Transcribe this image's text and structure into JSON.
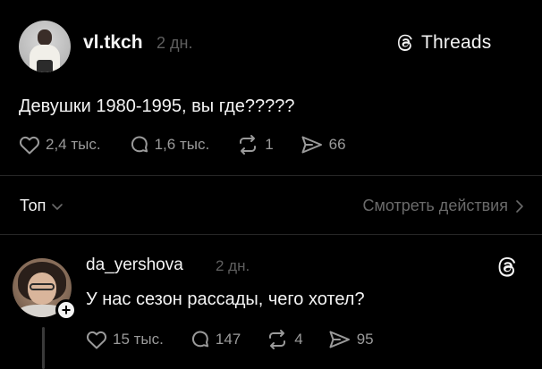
{
  "post": {
    "author": "vl.tkch",
    "time": "2 дн.",
    "brand": "Threads",
    "text": "Девушки 1980-1995, вы где?????",
    "stats": {
      "likes": "2,4 тыс.",
      "comments": "1,6 тыс.",
      "reposts": "1",
      "shares": "66"
    }
  },
  "filter": {
    "sort_label": "Топ",
    "activity_label": "Смотреть действия"
  },
  "reply": {
    "author": "da_yershova",
    "time": "2 дн.",
    "follow_symbol": "+",
    "text": "У нас сезон рассады, чего хотел?",
    "stats": {
      "likes": "15 тыс.",
      "comments": "147",
      "reposts": "4",
      "shares": "95"
    }
  },
  "colors": {
    "background": "#000000",
    "text": "#f4f4f4",
    "muted": "#9a9a9a",
    "divider": "#262626"
  },
  "icons": [
    "heart-icon",
    "comment-icon",
    "repost-icon",
    "share-icon",
    "threads-logo-icon",
    "chevron-down-icon",
    "chevron-right-icon"
  ]
}
